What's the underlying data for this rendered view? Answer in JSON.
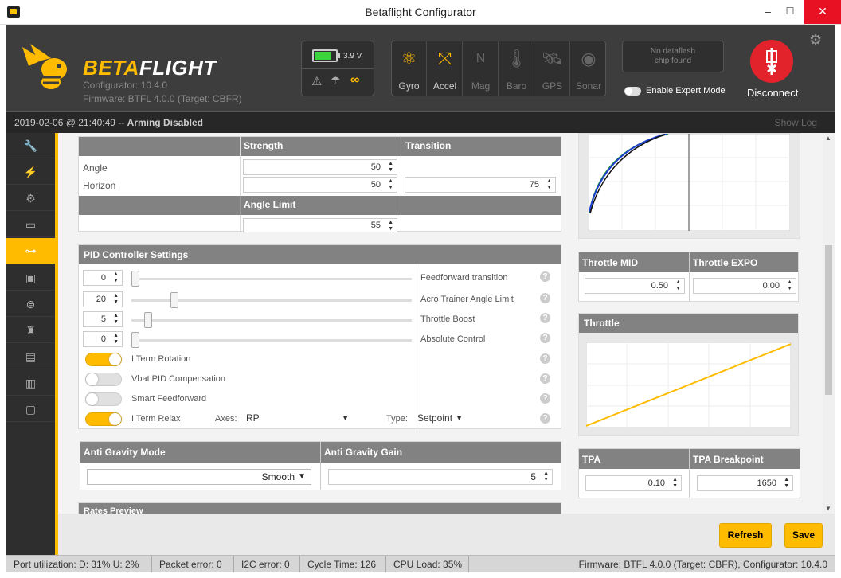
{
  "window": {
    "title": "Betaflight Configurator",
    "minimize": "–",
    "maximize": "☐",
    "close": "✕"
  },
  "header": {
    "brand_a": "BETA",
    "brand_b": "FLIGHT",
    "configurator": "Configurator: 10.4.0",
    "firmware": "Firmware: BTFL 4.0.0 (Target: CBFR)",
    "battery_voltage": "3.9 V",
    "battery_level": 0.8,
    "sensors": [
      {
        "label": "Gyro",
        "icon": "gyro-icon",
        "active": true
      },
      {
        "label": "Accel",
        "icon": "accel-icon",
        "active": true
      },
      {
        "label": "Mag",
        "icon": "mag-icon",
        "active": false
      },
      {
        "label": "Baro",
        "icon": "baro-icon",
        "active": false
      },
      {
        "label": "GPS",
        "icon": "gps-icon",
        "active": false
      },
      {
        "label": "Sonar",
        "icon": "sonar-icon",
        "active": false
      }
    ],
    "dataflash_line1": "No dataflash",
    "dataflash_line2": "chip found",
    "expert_mode": "Enable Expert Mode",
    "disconnect": "Disconnect"
  },
  "status": {
    "datetime": "2019-02-06 @ 21:40:49",
    "separator": " -- ",
    "arming": "Arming Disabled",
    "show_log": "Show Log"
  },
  "angle_table": {
    "col_strength": "Strength",
    "col_transition": "Transition",
    "row_angle": "Angle",
    "row_horizon": "Horizon",
    "angle_strength": "50",
    "horizon_strength": "50",
    "horizon_transition": "75",
    "angle_limit_header": "Angle Limit",
    "angle_limit": "55"
  },
  "pid_settings": {
    "title": "PID Controller Settings",
    "sliders": [
      {
        "value": "0",
        "label": "Feedforward transition",
        "pos": 0
      },
      {
        "value": "20",
        "label": "Acro Trainer Angle Limit",
        "pos": 0.15
      },
      {
        "value": "5",
        "label": "Throttle Boost",
        "pos": 0.04
      },
      {
        "value": "0",
        "label": "Absolute Control",
        "pos": 0
      }
    ],
    "toggles": [
      {
        "label": "I Term Rotation",
        "on": true
      },
      {
        "label": "Vbat PID Compensation",
        "on": false
      },
      {
        "label": "Smart Feedforward",
        "on": false
      },
      {
        "label": "I Term Relax",
        "on": true
      }
    ],
    "axes_label": "Axes:",
    "axes_value": "RP",
    "type_label": "Type:",
    "type_value": "Setpoint"
  },
  "anti_gravity": {
    "mode_header": "Anti Gravity Mode",
    "gain_header": "Anti Gravity Gain",
    "mode_value": "Smooth",
    "gain_value": "5"
  },
  "rates_preview": {
    "title": "Rates Preview"
  },
  "throttle": {
    "mid_header": "Throttle MID",
    "expo_header": "Throttle EXPO",
    "mid_value": "0.50",
    "expo_value": "0.00",
    "curve_title": "Throttle",
    "tpa_header": "TPA",
    "tpa_bp_header": "TPA Breakpoint",
    "tpa_value": "0.10",
    "tpa_bp_value": "1650"
  },
  "footer": {
    "refresh": "Refresh",
    "save": "Save"
  },
  "bottom": {
    "port": "Port utilization: D: 31% U: 2%",
    "packet": "Packet error: 0",
    "i2c": "I2C error: 0",
    "cycle": "Cycle Time: 126",
    "cpu": "CPU Load: 35%",
    "fw": "Firmware: BTFL 4.0.0 (Target: CBFR), Configurator: 10.4.0"
  },
  "colors": {
    "accent": "#ffbb00",
    "header_bg": "#3d3d3d",
    "disconnect": "#e2232c"
  }
}
